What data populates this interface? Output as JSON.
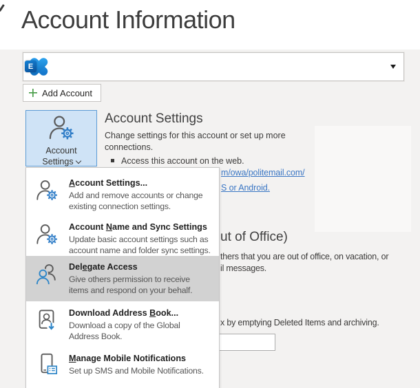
{
  "page": {
    "title": "Account Information"
  },
  "account_bar": {
    "selector": {
      "selected_account": "",
      "logo_letter": "E"
    },
    "add_account_label": "Add Account"
  },
  "tile": {
    "line1": "Account",
    "line2": "Settings"
  },
  "settings_section": {
    "heading": "Account Settings",
    "desc_line1": "Change settings for this account or set up more",
    "desc_line2": "connections.",
    "bullet_text": "Access this account on the web.",
    "link_fragment_1": "m/owa/politemail.com/",
    "link_fragment_2": "S or Android."
  },
  "auto_replies_section": {
    "heading_fragment": "ut of Office)",
    "line1_fragment": "thers that you are out of office, on vacation, or",
    "line2_fragment": "il messages."
  },
  "mailbox_section": {
    "line_fragment": "x by emptying Deleted Items and archiving."
  },
  "menu": {
    "items": [
      {
        "pre": "",
        "accel": "A",
        "post": "ccount Settings...",
        "desc1": "Add and remove accounts or change",
        "desc2": "existing connection settings.",
        "icon": "person-gear-icon",
        "highlighted": false
      },
      {
        "pre": "Account ",
        "accel": "N",
        "post": "ame and Sync Settings",
        "desc1": "Update basic account settings such as",
        "desc2": "account name and folder sync settings.",
        "icon": "person-gear-icon",
        "highlighted": false
      },
      {
        "pre": "Del",
        "accel": "e",
        "post": "gate Access",
        "desc1": "Give others permission to receive",
        "desc2": "items and respond on your behalf.",
        "icon": "delegate-people-icon",
        "highlighted": true
      },
      {
        "pre": "Download Address ",
        "accel": "B",
        "post": "ook...",
        "desc1": "Download a copy of the Global",
        "desc2": "Address Book.",
        "icon": "address-book-download-icon",
        "highlighted": false
      },
      {
        "pre": "",
        "accel": "M",
        "post": "anage Mobile Notifications",
        "desc1": "Set up SMS and Mobile Notifications.",
        "desc2": "",
        "icon": "mobile-notifications-icon",
        "highlighted": false
      }
    ]
  },
  "colors": {
    "accent_blue": "#2e7cc7",
    "tile_bg": "#cfe3f6",
    "tile_border": "#5b9bd5",
    "link_blue": "#3a76c4",
    "menu_highlight": "#d2d2d2",
    "add_plus_green": "#4a9e4a",
    "exchange_blue_dark": "#0a4f97",
    "exchange_blue_light": "#2ea3f2"
  }
}
